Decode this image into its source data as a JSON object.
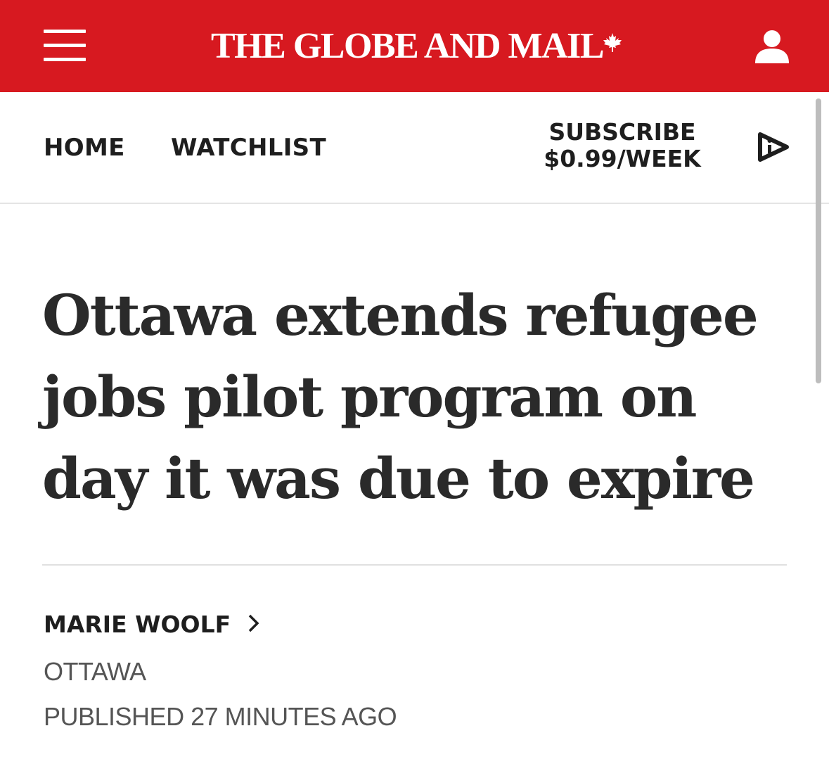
{
  "masthead": {
    "logo_text": "THE GLOBE AND MAIL",
    "menu_icon": "hamburger-menu-icon",
    "account_icon": "user-account-icon",
    "logo_icon": "maple-leaf-icon",
    "background_color": "#d71920"
  },
  "nav": {
    "home_label": "HOME",
    "watchlist_label": "WATCHLIST",
    "subscribe_line1": "SUBSCRIBE",
    "subscribe_line2": "$0.99/WEEK",
    "media_icon": "play-icon"
  },
  "article": {
    "headline": "Ottawa extends refugee jobs pilot program on day it was due to expire",
    "author": "MARIE WOOLF",
    "author_icon": "chevron-right-icon",
    "dateline": "OTTAWA",
    "published": "PUBLISHED 27 MINUTES AGO"
  }
}
